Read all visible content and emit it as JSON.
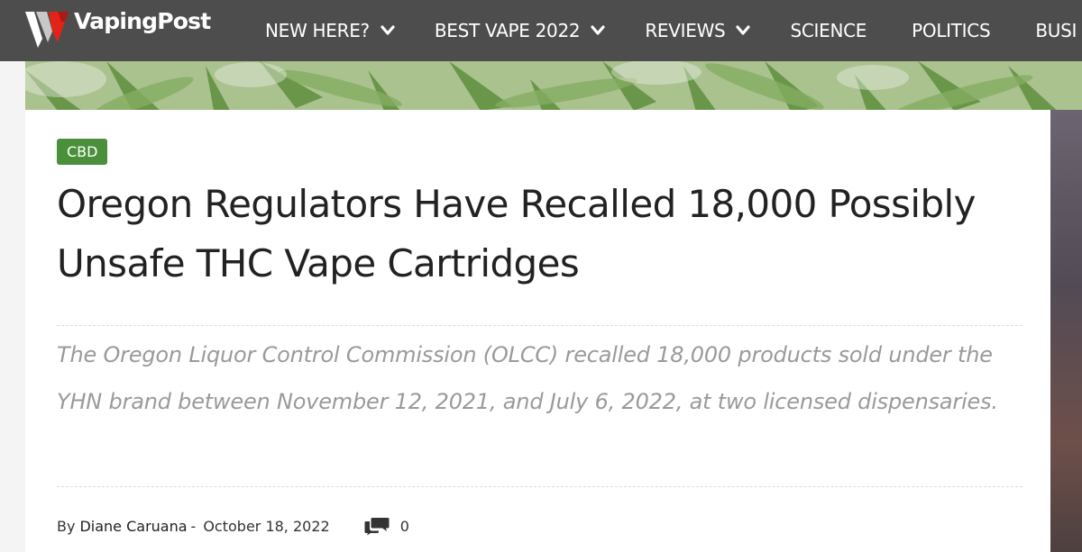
{
  "site": {
    "name": "VapingPost",
    "brand_color": "#e2231a",
    "nav_bg": "#4d4d4d"
  },
  "nav": {
    "items": [
      {
        "label": "NEW HERE?",
        "has_dropdown": true
      },
      {
        "label": "BEST VAPE 2022",
        "has_dropdown": true
      },
      {
        "label": "REVIEWS",
        "has_dropdown": true
      },
      {
        "label": "SCIENCE",
        "has_dropdown": false
      },
      {
        "label": "POLITICS",
        "has_dropdown": false
      },
      {
        "label": "BUSI",
        "has_dropdown": false
      }
    ]
  },
  "article": {
    "category": "CBD",
    "category_color": "#4a8f3a",
    "title": "Oregon Regulators Have Recalled 18,000 Possibly Unsafe THC Vape Cartridges",
    "excerpt": "The Oregon Liquor Control Commission (OLCC) recalled 18,000 products sold under the YHN brand between November 12, 2021, and July 6, 2022, at two licensed dispensaries.",
    "byline": {
      "by_label": "By",
      "author": "Diane Caruana",
      "separator": "-",
      "date": "October 18, 2022",
      "comment_count": "0"
    }
  },
  "icons": {
    "logo": "vapingpost-logo-icon",
    "nav_chevron": "chevron-down-icon",
    "comments": "comments-icon"
  }
}
